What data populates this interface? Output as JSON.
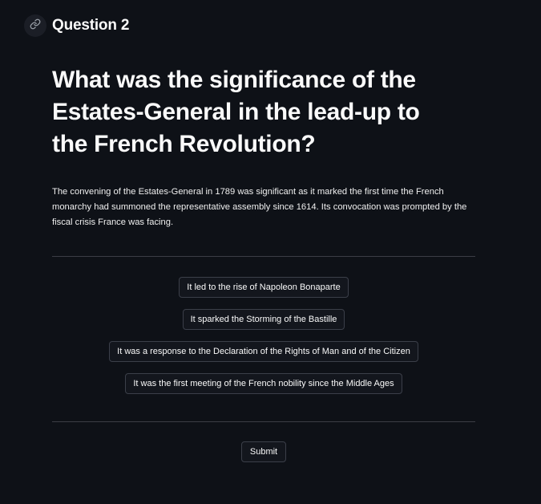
{
  "header": {
    "title": "Question 2",
    "link_icon": "link-icon"
  },
  "question": {
    "text": "What was the significance of the Estates-General in the lead-up to the French Revolution?",
    "context": "The convening of the Estates-General in 1789 was significant as it marked the first time the French monarchy had summoned the representative assembly since 1614. Its convocation was prompted by the fiscal crisis France was facing."
  },
  "options": [
    {
      "label": "It led to the rise of Napoleon Bonaparte"
    },
    {
      "label": "It sparked the Storming of the Bastille"
    },
    {
      "label": "It was a response to the Declaration of the Rights of Man and of the Citizen"
    },
    {
      "label": "It was the first meeting of the French nobility since the Middle Ages"
    }
  ],
  "submit": {
    "label": "Submit"
  },
  "colors": {
    "background": "#0e1117",
    "text": "#fafafa",
    "button_border": "#3b3f49",
    "divider": "#3b3d45"
  }
}
